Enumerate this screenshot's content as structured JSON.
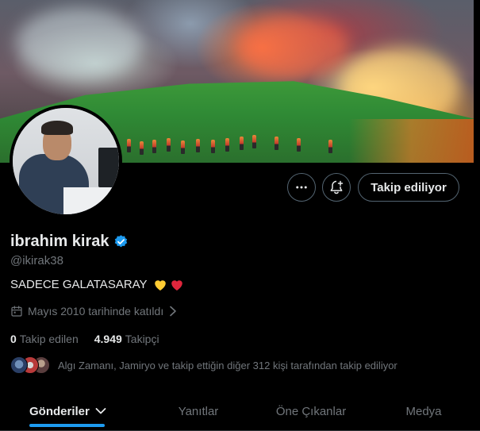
{
  "profile": {
    "name": "ibrahim kirak",
    "verified": true,
    "handle": "@ikirak38",
    "bio_text": "SADECE GALATASARAY",
    "bio_emojis": [
      "yellow-heart",
      "red-heart"
    ],
    "joined": "Mayıs 2010 tarihinde katıldı",
    "following_count": "0",
    "following_label": "Takip edilen",
    "followers_count": "4.949",
    "followers_label": "Takipçi",
    "followers_you_know": "Algı Zamanı, Jamiryo ve takip ettiğin diğer 312 kişi tarafından takip ediliyor"
  },
  "actions": {
    "more_icon": "more-horizontal-icon",
    "notify_icon": "bell-plus-icon",
    "follow_label": "Takip ediliyor"
  },
  "tabs": [
    {
      "label": "Gönderiler",
      "active": true,
      "dropdown": true
    },
    {
      "label": "Yanıtlar",
      "active": false
    },
    {
      "label": "Öne Çıkanlar",
      "active": false
    },
    {
      "label": "Medya",
      "active": false
    }
  ],
  "colors": {
    "background": "#000000",
    "accent": "#1d9bf0",
    "muted": "#71767b",
    "text": "#e7e9ea",
    "border": "#536471"
  }
}
